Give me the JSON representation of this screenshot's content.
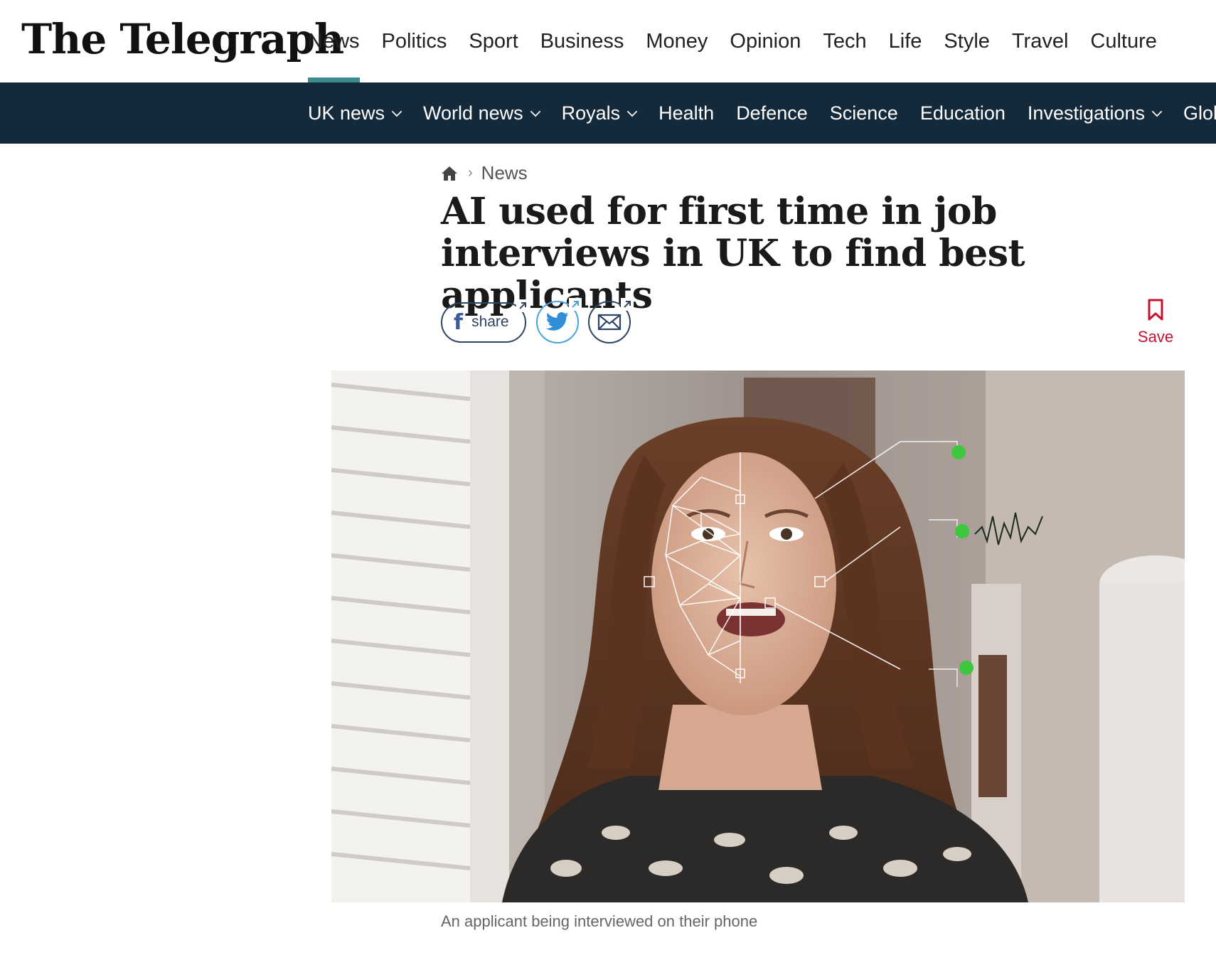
{
  "header": {
    "logo_text": "The Telegraph",
    "main_nav": [
      "News",
      "Politics",
      "Sport",
      "Business",
      "Money",
      "Opinion",
      "Tech",
      "Life",
      "Style",
      "Travel",
      "Culture"
    ],
    "active_index": 0,
    "accent_color": "#3a8c8f"
  },
  "subnav": {
    "background": "#142a3b",
    "items": [
      {
        "label": "UK news",
        "has_dropdown": true
      },
      {
        "label": "World news",
        "has_dropdown": true
      },
      {
        "label": "Royals",
        "has_dropdown": true
      },
      {
        "label": "Health",
        "has_dropdown": false
      },
      {
        "label": "Defence",
        "has_dropdown": false
      },
      {
        "label": "Science",
        "has_dropdown": false
      },
      {
        "label": "Education",
        "has_dropdown": false
      },
      {
        "label": "Investigations",
        "has_dropdown": true
      },
      {
        "label": "Glob",
        "has_dropdown": false
      }
    ]
  },
  "breadcrumb": {
    "home_icon": "home-icon",
    "section": "News"
  },
  "article": {
    "headline": "AI used for first time in job interviews in UK to find best applicants",
    "share": {
      "facebook_label": "share",
      "facebook_icon": "facebook-icon",
      "twitter_icon": "twitter-icon",
      "email_icon": "email-icon"
    },
    "save_label": "Save",
    "save_color": "#c8102e",
    "caption": "An applicant being interviewed on their phone"
  }
}
